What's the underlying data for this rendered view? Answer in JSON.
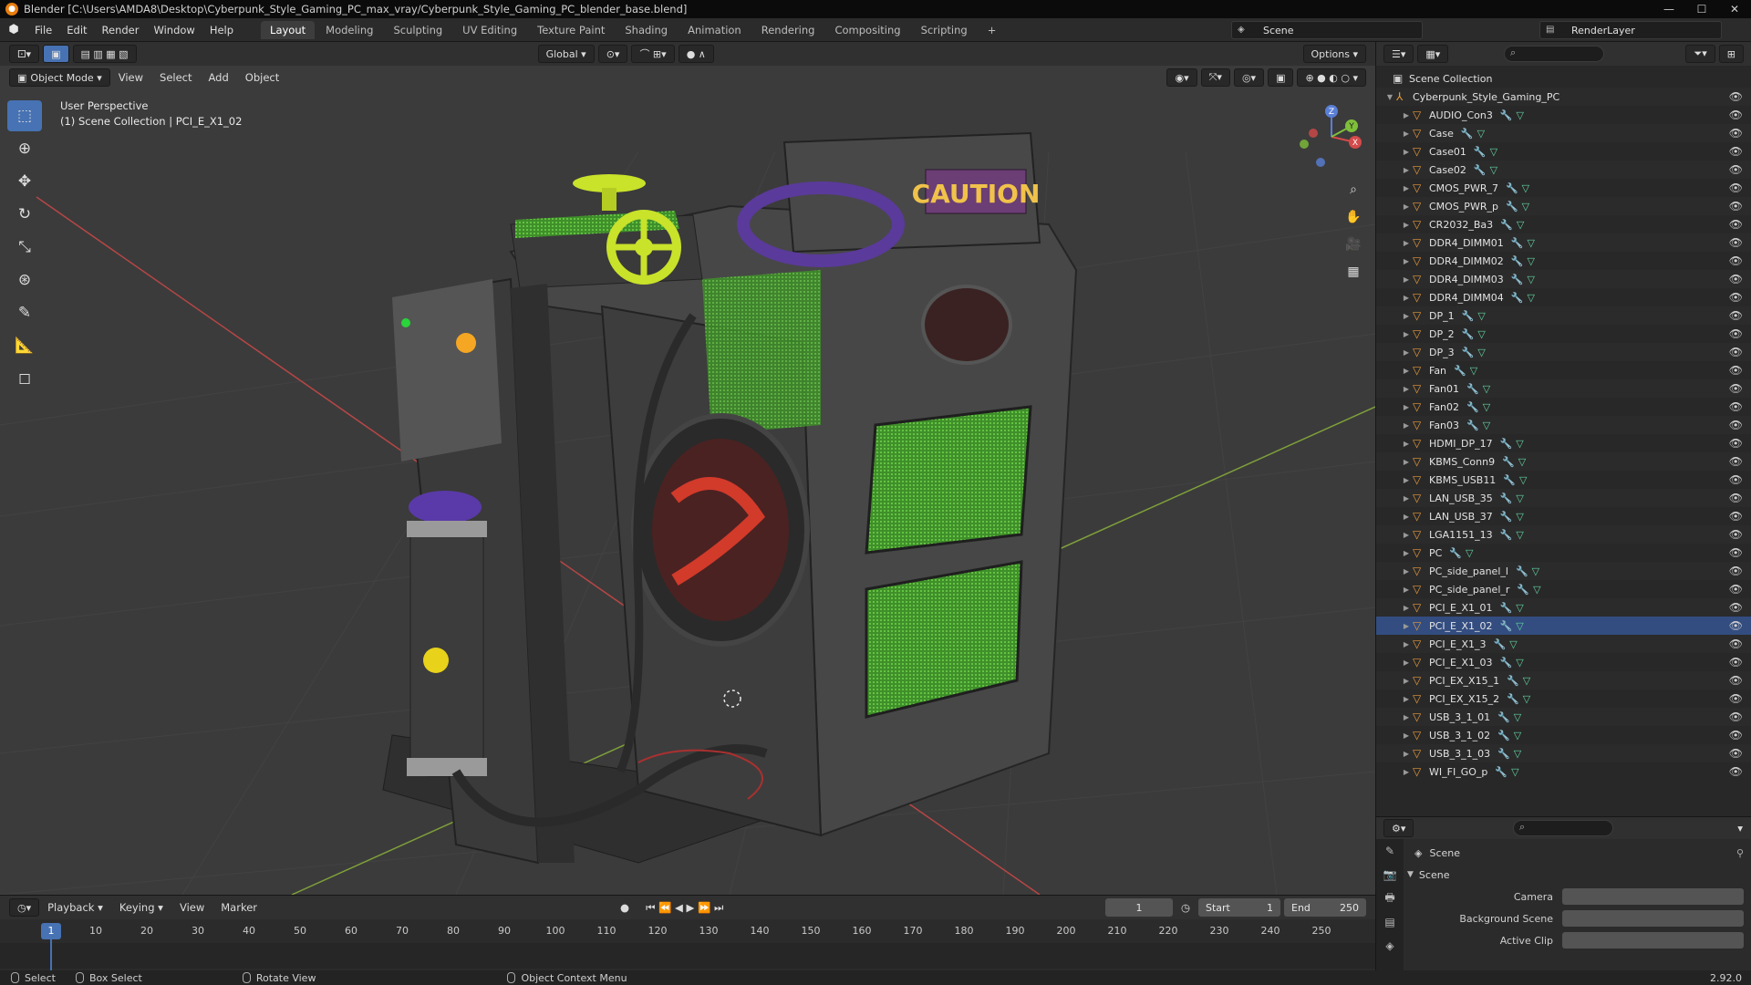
{
  "window": {
    "title": "Blender [C:\\Users\\AMDA8\\Desktop\\Cyberpunk_Style_Gaming_PC_max_vray/Cyberpunk_Style_Gaming_PC_blender_base.blend]",
    "minimize": "—",
    "maximize": "☐",
    "close": "✕"
  },
  "menu": [
    "File",
    "Edit",
    "Render",
    "Window",
    "Help"
  ],
  "workspaces": [
    "Layout",
    "Modeling",
    "Sculpting",
    "UV Editing",
    "Texture Paint",
    "Shading",
    "Animation",
    "Rendering",
    "Compositing",
    "Scripting"
  ],
  "active_workspace": "Layout",
  "add_workspace": "+",
  "scene_name": "Scene",
  "render_layer": "RenderLayer",
  "viewport": {
    "mode": "Object Mode",
    "menus": [
      "View",
      "Select",
      "Add",
      "Object"
    ],
    "transform_orientation": "Global",
    "options": "Options",
    "perspective": "User Perspective",
    "collection_info": "(1) Scene Collection | PCI_E_X1_02",
    "caution_text": "CAUTION",
    "gizmo_axes": [
      "X",
      "Y",
      "Z"
    ]
  },
  "timeline": {
    "menus": [
      "Playback",
      "Keying",
      "View",
      "Marker"
    ],
    "current_frame": "1",
    "start_label": "Start",
    "start": "1",
    "end_label": "End",
    "end": "250",
    "ticks": [
      "10",
      "20",
      "30",
      "40",
      "50",
      "60",
      "70",
      "80",
      "90",
      "100",
      "110",
      "120",
      "130",
      "140",
      "150",
      "160",
      "170",
      "180",
      "190",
      "200",
      "210",
      "220",
      "230",
      "240",
      "250"
    ],
    "playhead": "1"
  },
  "status": {
    "select": "Select",
    "box_select": "Box Select",
    "rotate_view": "Rotate View",
    "context_menu": "Object Context Menu",
    "version": "2.92.0"
  },
  "outliner": {
    "root": "Scene Collection",
    "collection": "Cyberpunk_Style_Gaming_PC",
    "selected": "PCI_E_X1_02",
    "items": [
      "AUDIO_Con3",
      "Case",
      "Case01",
      "Case02",
      "CMOS_PWR_7",
      "CMOS_PWR_p",
      "CR2032_Ba3",
      "DDR4_DIMM01",
      "DDR4_DIMM02",
      "DDR4_DIMM03",
      "DDR4_DIMM04",
      "DP_1",
      "DP_2",
      "DP_3",
      "Fan",
      "Fan01",
      "Fan02",
      "Fan03",
      "HDMI_DP_17",
      "KBMS_Conn9",
      "KBMS_USB11",
      "LAN_USB_35",
      "LAN_USB_37",
      "LGA1151_13",
      "PC",
      "PC_side_panel_l",
      "PC_side_panel_r",
      "PCI_E_X1_01",
      "PCI_E_X1_02",
      "PCI_E_X1_3",
      "PCI_E_X1_03",
      "PCI_EX_X15_1",
      "PCI_EX_X15_2",
      "USB_3_1_01",
      "USB_3_1_02",
      "USB_3_1_03",
      "WI_FI_GO_p"
    ]
  },
  "properties": {
    "context": "Scene",
    "panel": "Scene",
    "fields": [
      {
        "label": "Camera"
      },
      {
        "label": "Background Scene"
      },
      {
        "label": "Active Clip"
      }
    ]
  },
  "colors": {
    "accent": "#4772b3",
    "mesh_icon": "#e69a3c",
    "modifier_icon": "#6ea1e6",
    "data_icon": "#63d1a0",
    "grid_red": "#c84a4a",
    "grid_green": "#7fb03a",
    "mesh_green": "#5fc23a"
  }
}
